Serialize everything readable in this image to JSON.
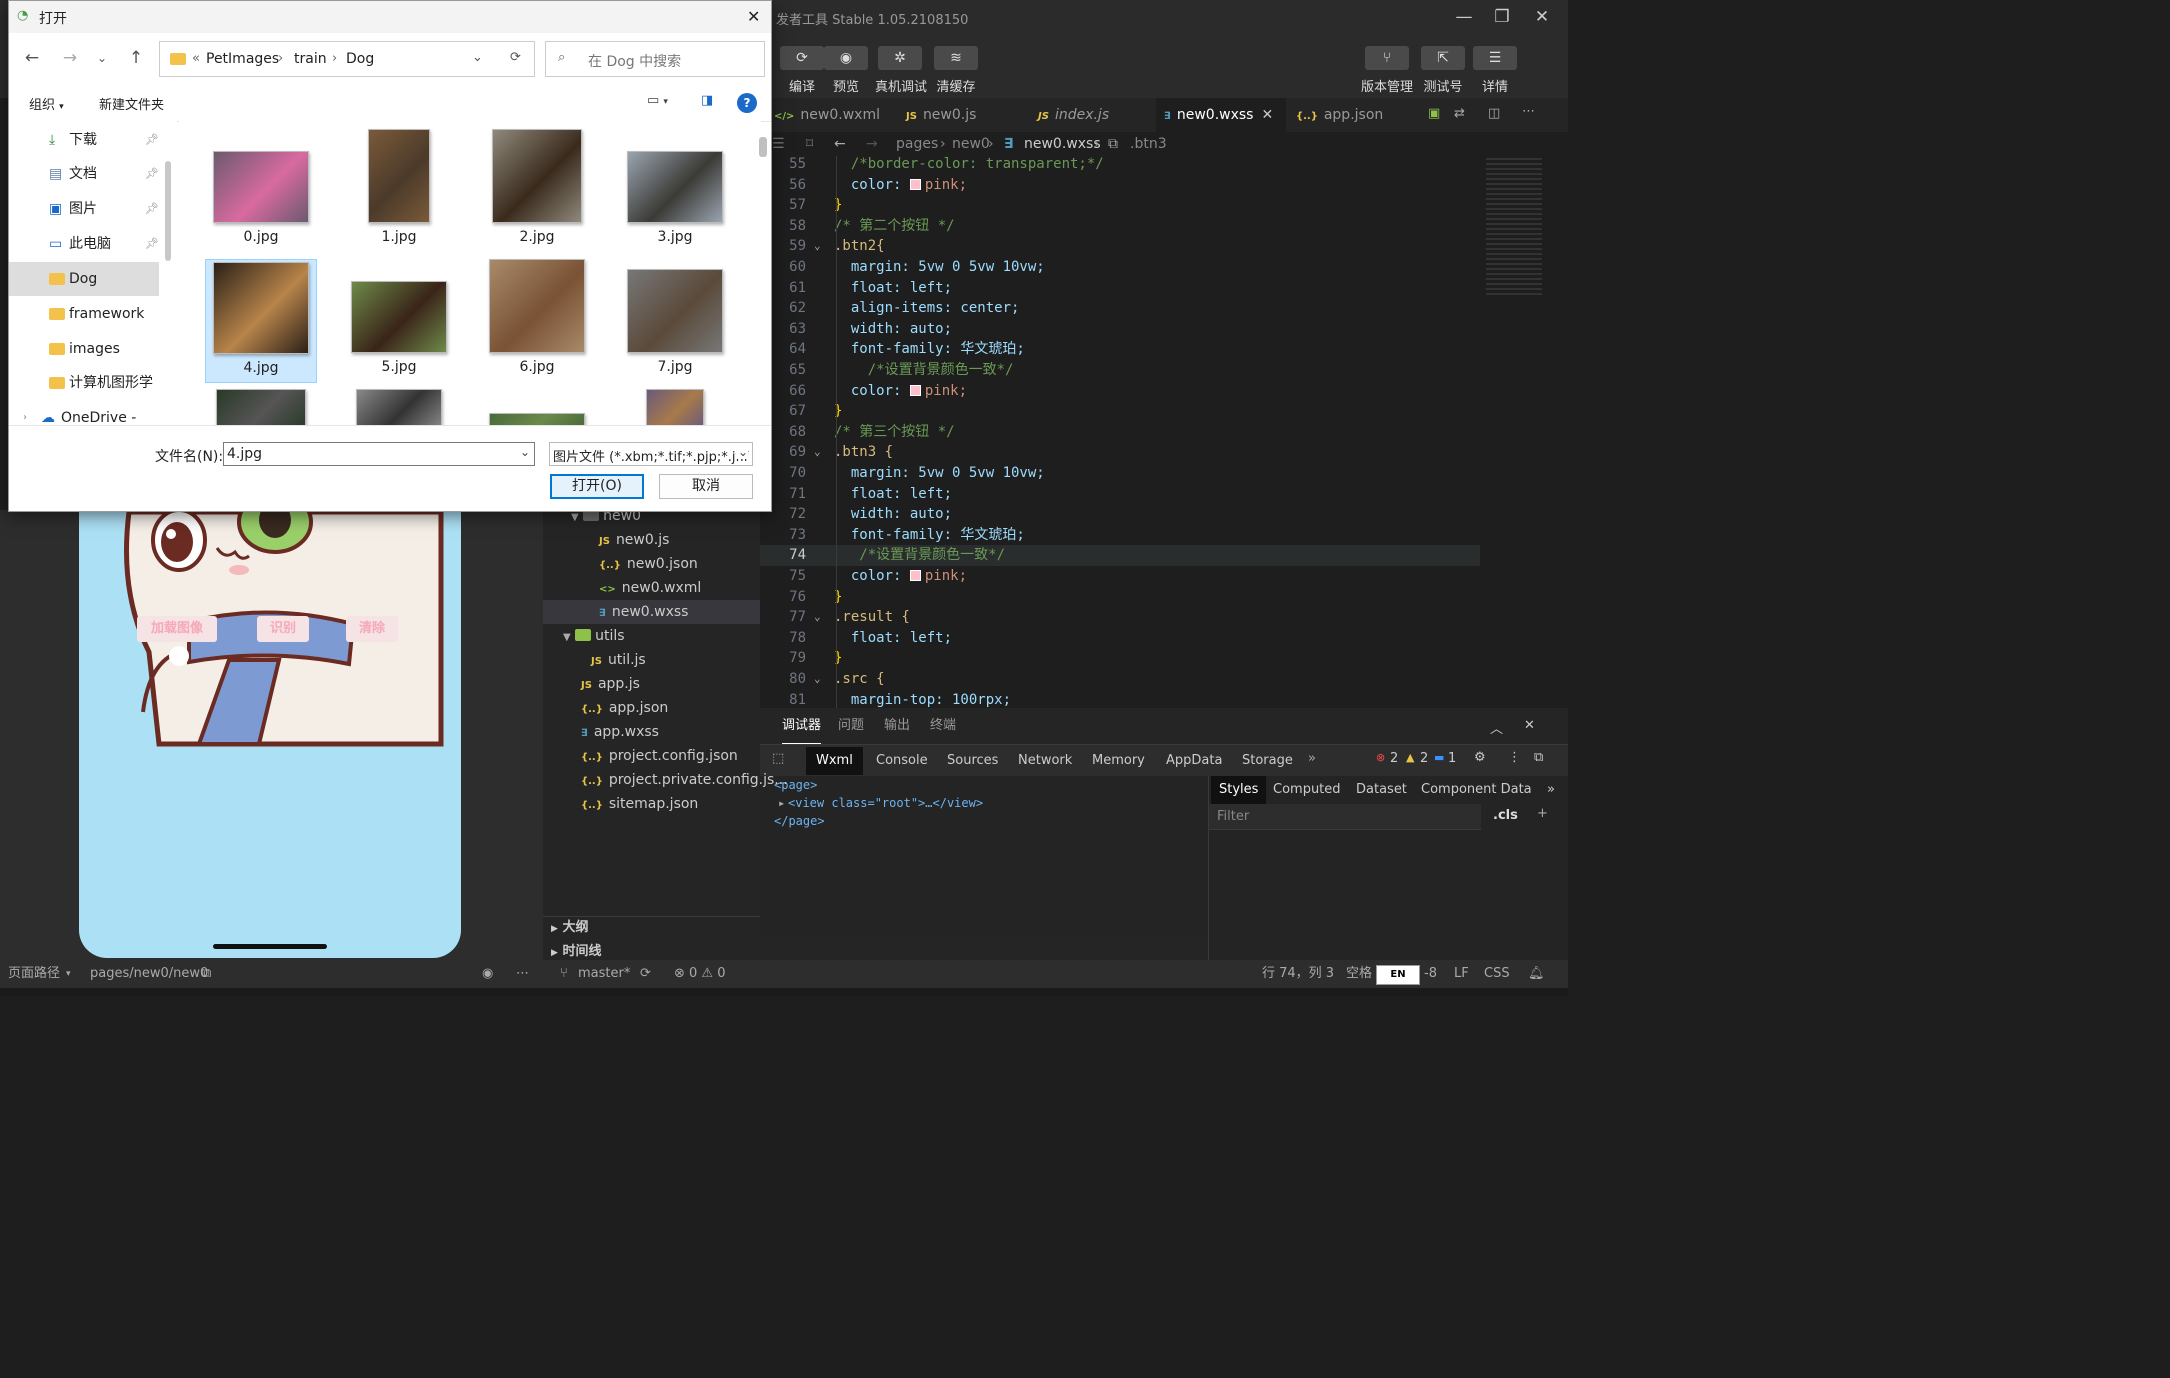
{
  "app": {
    "title": "发者工具 Stable 1.05.2108150",
    "window_controls": {
      "min": "—",
      "max": "❐",
      "close": "✕"
    }
  },
  "toolbar": {
    "left": [
      {
        "label": "编译",
        "icon": "refresh-icon",
        "glyph": "⟳"
      },
      {
        "label": "预览",
        "icon": "eye-icon",
        "glyph": "◉"
      },
      {
        "label": "真机调试",
        "icon": "bug-icon",
        "glyph": "✲"
      },
      {
        "label": "清缓存",
        "icon": "layers-icon",
        "glyph": "≋"
      }
    ],
    "right": [
      {
        "label": "版本管理",
        "icon": "branch-icon",
        "glyph": "⑂"
      },
      {
        "label": "测试号",
        "icon": "external-link-icon",
        "glyph": "⇱"
      },
      {
        "label": "详情",
        "icon": "menu-icon",
        "glyph": "☰"
      }
    ]
  },
  "editor": {
    "tabs": [
      {
        "name": "new0.wxml",
        "icon": "</>",
        "type": "wxml"
      },
      {
        "name": "new0.js",
        "icon": "JS",
        "type": "js"
      },
      {
        "name": "index.js",
        "icon": "JS",
        "type": "js"
      },
      {
        "name": "new0.wxss",
        "icon": "∃",
        "type": "css",
        "active": true
      },
      {
        "name": "app.json",
        "icon": "{..}",
        "type": "json"
      }
    ],
    "breadcrumb": [
      "pages",
      "new0",
      "new0.wxss",
      ".btn3"
    ],
    "code_lines": [
      {
        "n": "55",
        "t": "  /*border-color: transparent;*/",
        "k": "com"
      },
      {
        "n": "56",
        "t": "  color: pink;",
        "k": "color"
      },
      {
        "n": "57",
        "t": "}",
        "k": "brace"
      },
      {
        "n": "58",
        "t": "/* 第二个按钮 */",
        "k": "com"
      },
      {
        "n": "59",
        "t": ".btn2{",
        "k": "sel",
        "fold": true
      },
      {
        "n": "60",
        "t": "  margin: 5vw 0 5vw 10vw;",
        "k": "prop"
      },
      {
        "n": "61",
        "t": "  float: left;",
        "k": "prop"
      },
      {
        "n": "62",
        "t": "  align-items: center;",
        "k": "prop"
      },
      {
        "n": "63",
        "t": "  width: auto;",
        "k": "prop"
      },
      {
        "n": "64",
        "t": "  font-family: 华文琥珀;",
        "k": "prop"
      },
      {
        "n": "65",
        "t": "    /*设置背景颜色一致*/",
        "k": "com"
      },
      {
        "n": "66",
        "t": "  color: pink;",
        "k": "color"
      },
      {
        "n": "67",
        "t": "}",
        "k": "brace"
      },
      {
        "n": "68",
        "t": "/* 第三个按钮 */",
        "k": "com"
      },
      {
        "n": "69",
        "t": ".btn3 {",
        "k": "sel",
        "fold": true
      },
      {
        "n": "70",
        "t": "  margin: 5vw 0 5vw 10vw;",
        "k": "prop"
      },
      {
        "n": "71",
        "t": "  float: left;",
        "k": "prop"
      },
      {
        "n": "72",
        "t": "  width: auto;",
        "k": "prop"
      },
      {
        "n": "73",
        "t": "  font-family: 华文琥珀;",
        "k": "prop"
      },
      {
        "n": "74",
        "t": "   /*设置背景颜色一致*/",
        "k": "com",
        "current": true
      },
      {
        "n": "75",
        "t": "  color: pink;",
        "k": "color"
      },
      {
        "n": "76",
        "t": "}",
        "k": "brace"
      },
      {
        "n": "77",
        "t": ".result {",
        "k": "sel",
        "fold": true
      },
      {
        "n": "78",
        "t": "  float: left;",
        "k": "prop"
      },
      {
        "n": "79",
        "t": "}",
        "k": "brace"
      },
      {
        "n": "80",
        "t": ".src {",
        "k": "sel",
        "fold": true
      },
      {
        "n": "81",
        "t": "  margin-top: 100rpx;",
        "k": "prop"
      }
    ]
  },
  "debugger": {
    "tabs": [
      "调试器",
      "问题",
      "输出",
      "终端"
    ],
    "panels": [
      "Wxml",
      "Console",
      "Sources",
      "Network",
      "Memory",
      "AppData",
      "Storage"
    ],
    "badges": {
      "errors": "2",
      "warnings": "2",
      "info": "1"
    },
    "wxml": [
      "<page>",
      "<view class=\"root\">…</view>",
      "</page>"
    ],
    "style_tabs": [
      "Styles",
      "Computed",
      "Dataset",
      "Component Data"
    ],
    "filter_placeholder": "Filter",
    "cls": ".cls"
  },
  "simulator": {
    "buttons": [
      "加载图像",
      "识别",
      "清除"
    ]
  },
  "file_tree": {
    "items": [
      {
        "name": "new0",
        "kind": "folder"
      },
      {
        "name": "new0.js",
        "kind": "js"
      },
      {
        "name": "new0.json",
        "kind": "json"
      },
      {
        "name": "new0.wxml",
        "kind": "wxml"
      },
      {
        "name": "new0.wxss",
        "kind": "css",
        "selected": true
      },
      {
        "name": "utils",
        "kind": "folder"
      },
      {
        "name": "util.js",
        "kind": "js"
      },
      {
        "name": "app.js",
        "kind": "js"
      },
      {
        "name": "app.json",
        "kind": "json"
      },
      {
        "name": "app.wxss",
        "kind": "css"
      },
      {
        "name": "project.config.json",
        "kind": "json"
      },
      {
        "name": "project.private.config.js...",
        "kind": "json"
      },
      {
        "name": "sitemap.json",
        "kind": "json"
      }
    ],
    "sections": [
      "大纲",
      "时间线"
    ]
  },
  "status": {
    "page_path_label": "页面路径",
    "page_path": "pages/new0/new0",
    "branch": "master*",
    "problems": "⊗ 0 ⚠ 0",
    "cursor": "行 74，列 3",
    "spaces": "空格",
    "enc_suffix": "-8",
    "eol": "LF",
    "lang": "CSS",
    "ime": "EN"
  },
  "dialog": {
    "title": "打开",
    "close": "✕",
    "address": [
      "«",
      "PetImages",
      "train",
      "Dog"
    ],
    "search_placeholder": "在 Dog 中搜索",
    "organize": "组织",
    "new_folder": "新建文件夹",
    "nav": [
      {
        "label": "下载",
        "icon": "download-icon",
        "pinned": true
      },
      {
        "label": "文档",
        "icon": "document-icon",
        "pinned": true
      },
      {
        "label": "图片",
        "icon": "pictures-icon",
        "pinned": true
      },
      {
        "label": "此电脑",
        "icon": "computer-icon",
        "pinned": true
      },
      {
        "label": "Dog",
        "icon": "folder-icon",
        "selected": true
      },
      {
        "label": "framework",
        "icon": "folder-icon"
      },
      {
        "label": "images",
        "icon": "folder-icon"
      },
      {
        "label": "计算机图形学",
        "icon": "folder-icon"
      },
      {
        "label": "OneDrive - Pers...",
        "icon": "cloud-icon"
      }
    ],
    "files": [
      {
        "name": "0.jpg",
        "c1": "#6b5a6e",
        "c2": "#d86aa0"
      },
      {
        "name": "1.jpg",
        "c1": "#7a5a3a",
        "c2": "#4b3a2a"
      },
      {
        "name": "2.jpg",
        "c1": "#8f8a7c",
        "c2": "#3a2a1c"
      },
      {
        "name": "3.jpg",
        "c1": "#9aa5b0",
        "c2": "#3b3a36"
      },
      {
        "name": "4.jpg",
        "c1": "#2a2018",
        "c2": "#b8844a",
        "selected": true
      },
      {
        "name": "5.jpg",
        "c1": "#6e8a4a",
        "c2": "#3a2418"
      },
      {
        "name": "6.jpg",
        "c1": "#a88a6a",
        "c2": "#7a5236"
      },
      {
        "name": "7.jpg",
        "c1": "#777",
        "c2": "#5a4a3a"
      },
      {
        "name": "",
        "c1": "#2a3a28",
        "c2": "#555"
      },
      {
        "name": "",
        "c1": "#888",
        "c2": "#333"
      },
      {
        "name": "",
        "c1": "#4a6a3a",
        "c2": "#6a8a4a"
      },
      {
        "name": "",
        "c1": "#6a5a7a",
        "c2": "#a87a4a"
      }
    ],
    "filename_label": "文件名(N):",
    "filename_value": "4.jpg",
    "filetype": "图片文件 (*.xbm;*.tif;*.pjp;*.jfif",
    "open_button": "打开(O)",
    "cancel_button": "取消"
  },
  "colors": {
    "accent": "#0078d4",
    "editor_bg": "#1e1e1e",
    "phone_bg": "#ace0f5",
    "pink": "#ffc0cb"
  }
}
